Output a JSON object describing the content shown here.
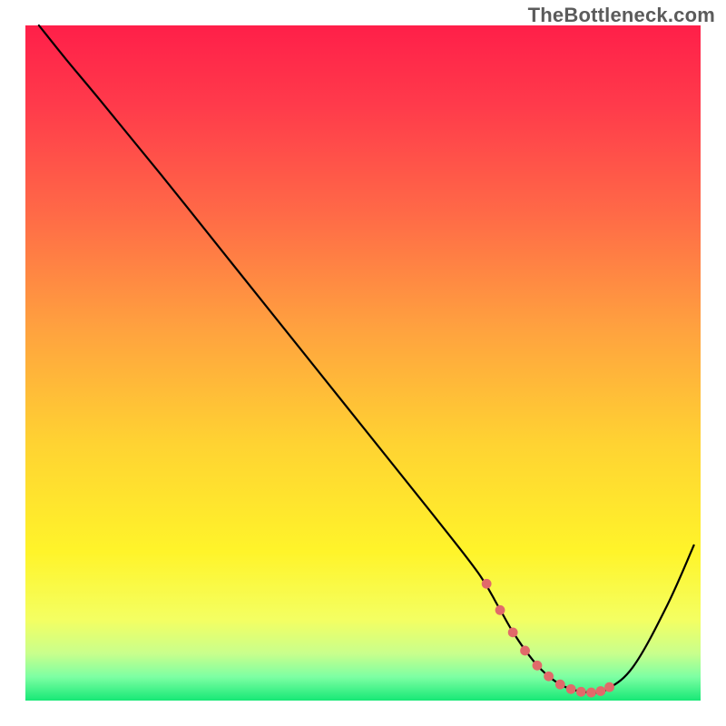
{
  "watermark": "TheBottleneck.com",
  "chart_data": {
    "type": "line",
    "title": "",
    "xlabel": "",
    "ylabel": "",
    "xlim": [
      0,
      100
    ],
    "ylim": [
      0,
      100
    ],
    "grid": false,
    "background_gradient": {
      "stops": [
        {
          "pos": 0.0,
          "color": "#ff1f49"
        },
        {
          "pos": 0.12,
          "color": "#ff3b4b"
        },
        {
          "pos": 0.28,
          "color": "#ff6a47"
        },
        {
          "pos": 0.45,
          "color": "#ffa23f"
        },
        {
          "pos": 0.62,
          "color": "#ffd332"
        },
        {
          "pos": 0.78,
          "color": "#fff42a"
        },
        {
          "pos": 0.88,
          "color": "#f4ff62"
        },
        {
          "pos": 0.93,
          "color": "#c9ff8c"
        },
        {
          "pos": 0.965,
          "color": "#7dffa3"
        },
        {
          "pos": 1.0,
          "color": "#17e876"
        }
      ]
    },
    "series": [
      {
        "name": "bottleneck-curve",
        "x": [
          2,
          6,
          11,
          20,
          30,
          40,
          50,
          60,
          67,
          70,
          72,
          74,
          76,
          78,
          80,
          82,
          84,
          86,
          90,
          95,
          99
        ],
        "y": [
          100,
          95,
          89,
          78,
          65.5,
          53,
          40.5,
          28,
          19,
          14,
          10.5,
          7.5,
          5,
          3.2,
          2.0,
          1.4,
          1.2,
          1.6,
          5,
          14,
          23
        ]
      }
    ],
    "markers": {
      "name": "optimal-range-markers",
      "x": [
        68.3,
        70.3,
        72.2,
        74.0,
        75.8,
        77.5,
        79.2,
        80.8,
        82.3,
        83.8,
        85.2,
        86.5
      ],
      "y": [
        17.3,
        13.4,
        10.1,
        7.4,
        5.2,
        3.6,
        2.4,
        1.7,
        1.3,
        1.2,
        1.4,
        2.0
      ]
    }
  }
}
